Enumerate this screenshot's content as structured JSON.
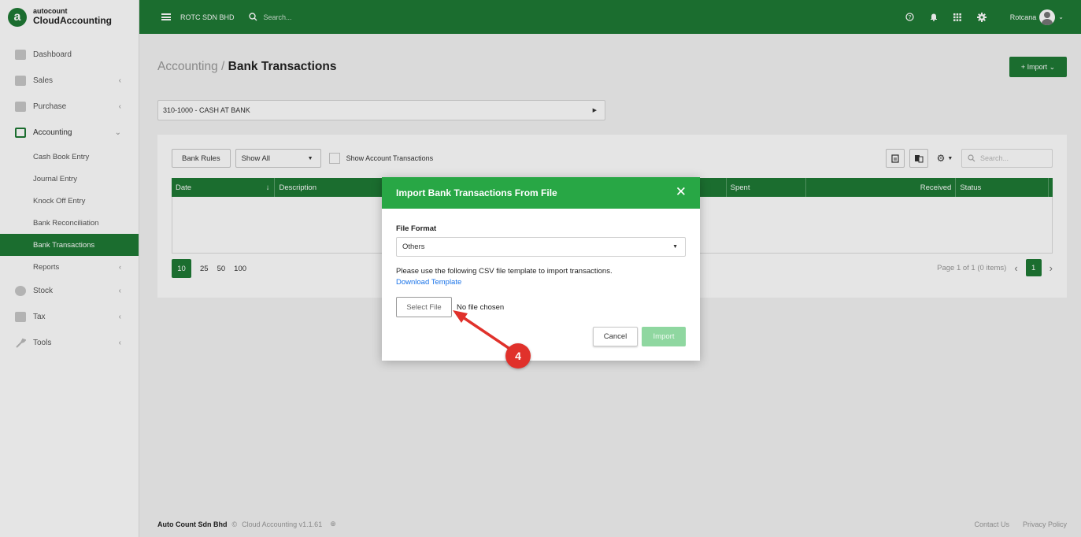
{
  "brand": {
    "top": "autocount",
    "bottom": "CloudAccounting",
    "mark": "a"
  },
  "topbar": {
    "company": "ROTC SDN BHD",
    "search_placeholder": "Search...",
    "user": "Rotcana"
  },
  "sidebar": {
    "items": [
      {
        "label": "Dashboard",
        "icon": "dashboard-icon"
      },
      {
        "label": "Sales",
        "icon": "sales-icon",
        "chevron": "‹"
      },
      {
        "label": "Purchase",
        "icon": "purchase-icon",
        "chevron": "‹"
      },
      {
        "label": "Accounting",
        "icon": "accounting-icon",
        "chevron": "⌄"
      }
    ],
    "sub_items": [
      {
        "label": "Cash Book Entry"
      },
      {
        "label": "Journal Entry"
      },
      {
        "label": "Knock Off Entry"
      },
      {
        "label": "Bank Reconciliation"
      },
      {
        "label": "Bank Transactions"
      },
      {
        "label": "Reports",
        "chevron": "‹"
      }
    ],
    "items2": [
      {
        "label": "Stock",
        "icon": "stock-icon",
        "chevron": "‹"
      },
      {
        "label": "Tax",
        "icon": "tax-icon",
        "chevron": "‹"
      },
      {
        "label": "Tools",
        "icon": "tools-icon",
        "chevron": "‹"
      }
    ]
  },
  "page": {
    "breadcrumb_parent": "Accounting",
    "breadcrumb_sep": " / ",
    "title": "Bank Transactions",
    "import_button": "+ Import ⌄",
    "account": "310-1000 - CASH AT BANK"
  },
  "toolbar": {
    "bank_rules": "Bank Rules",
    "show_filter": "Show All",
    "show_account_tx": "Show Account Transactions",
    "search_placeholder": "Search..."
  },
  "table": {
    "columns": [
      "Date",
      "Description",
      "Spent",
      "Received",
      "Status",
      ""
    ],
    "page_sizes": [
      "10",
      "25",
      "50",
      "100"
    ],
    "page_info": "Page 1 of 1 (0 items)",
    "current_page": "1"
  },
  "footer": {
    "company": "Auto Count Sdn Bhd",
    "copyright": "©",
    "version": "Cloud Accounting v1.1.61",
    "contact": "Contact Us",
    "privacy": "Privacy Policy"
  },
  "modal": {
    "title": "Import Bank Transactions From File",
    "close": "✕",
    "file_format_label": "File Format",
    "file_format_value": "Others",
    "info": "Please use the following CSV file template to import transactions.",
    "download_link": "Download Template",
    "select_file": "Select File",
    "no_file": "No file chosen",
    "cancel": "Cancel",
    "import": "Import"
  },
  "annotation": {
    "step": "4"
  },
  "colors": {
    "brand_green": "#1f7a35",
    "modal_green": "#28a745",
    "arrow_red": "#e0312b"
  }
}
